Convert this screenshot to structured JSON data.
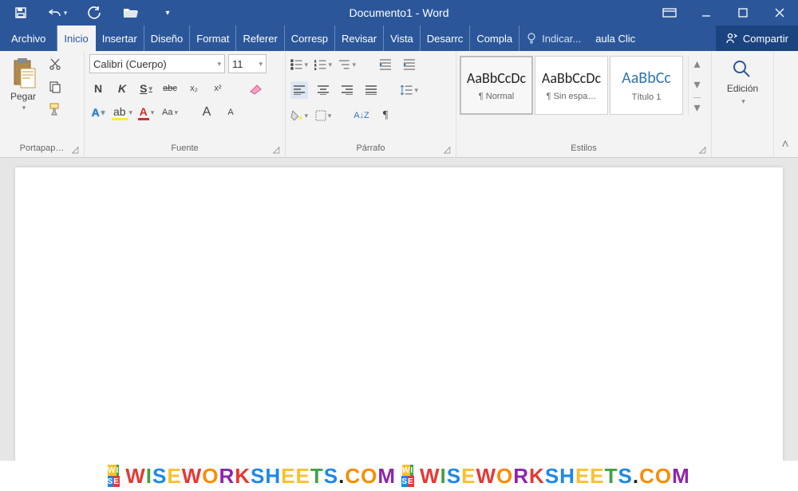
{
  "titlebar": {
    "title": "Documento1 - Word"
  },
  "tabs": {
    "file": "Archivo",
    "items": [
      "Inicio",
      "Insertar",
      "Diseño",
      "Format",
      "Referer",
      "Corresp",
      "Revisar",
      "Vista",
      "Desarrc",
      "Compla"
    ],
    "active_index": 0,
    "tellme": "Indicar...",
    "link": "aula Clic",
    "share": "Compartir"
  },
  "ribbon": {
    "clipboard": {
      "paste": "Pegar",
      "label": "Portapap…"
    },
    "font": {
      "name": "Calibri (Cuerpo)",
      "size": "11",
      "bold": "N",
      "italic": "K",
      "underline": "S",
      "strike": "abc",
      "sub": "x₂",
      "sup": "x²",
      "caseBtn": "Aa",
      "growA": "A",
      "shrinkA": "A",
      "textfx": "A",
      "label": "Fuente"
    },
    "paragraph": {
      "label": "Párrafo",
      "sort": "A↓Z",
      "pilcrow": "¶"
    },
    "styles": {
      "label": "Estilos",
      "cards": [
        {
          "preview": "AaBbCcDc",
          "name": "¶ Normal"
        },
        {
          "preview": "AaBbCcDc",
          "name": "¶ Sin espa…"
        },
        {
          "preview": "AaBbCc",
          "name": "Título 1"
        }
      ]
    },
    "editing": {
      "label": "Edición"
    }
  },
  "watermark": "WISEWORKSHEETS.COM"
}
